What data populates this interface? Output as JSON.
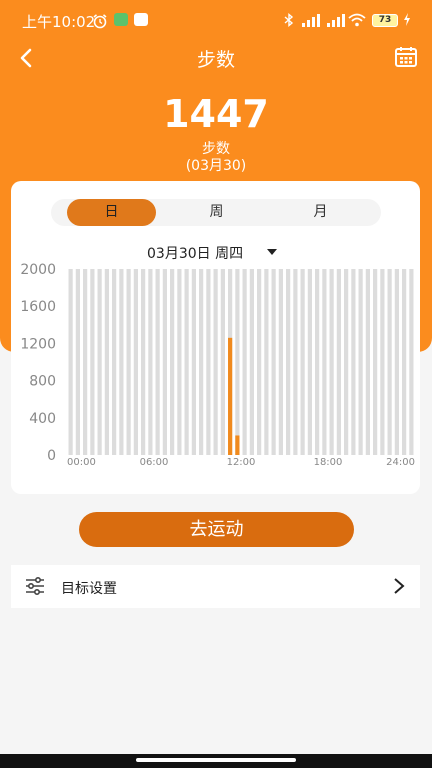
{
  "status_bar": {
    "time": "上午10:02",
    "battery": "73"
  },
  "header": {
    "title": "步数"
  },
  "summary": {
    "steps": "1447",
    "unit": "步数",
    "date": "(03月30)"
  },
  "tabs": [
    {
      "label": "日",
      "active": true
    },
    {
      "label": "周",
      "active": false
    },
    {
      "label": "月",
      "active": false
    }
  ],
  "date_selector": {
    "label": "03月30日 周四"
  },
  "chart_data": {
    "type": "bar",
    "x_tick_labels": [
      "00:00",
      "06:00",
      "12:00",
      "18:00",
      "24:00"
    ],
    "y_tick_labels": [
      "2000",
      "1600",
      "1200",
      "800",
      "400",
      "0"
    ],
    "ylim": [
      0,
      2000
    ],
    "bin_count": 48,
    "values": [
      0,
      0,
      0,
      0,
      0,
      0,
      0,
      0,
      0,
      0,
      0,
      0,
      0,
      0,
      0,
      0,
      0,
      0,
      0,
      0,
      0,
      0,
      1260,
      210,
      0,
      0,
      0,
      0,
      0,
      0,
      0,
      0,
      0,
      0,
      0,
      0,
      0,
      0,
      0,
      0,
      0,
      0,
      0,
      0,
      0,
      0,
      0,
      0
    ],
    "colors": {
      "bar": "#f08a1e",
      "track": "#dcdcdc"
    }
  },
  "go_button": {
    "label": "去运动"
  },
  "goal_row": {
    "label": "目标设置"
  },
  "colors": {
    "primary": "#fb8c1e",
    "button": "#d96c0f",
    "tab_active": "#e0791b"
  },
  "icons": {
    "back": "chevron-left-icon",
    "calendar": "calendar-icon",
    "settings": "sliders-icon",
    "forward": "chevron-right-icon"
  }
}
